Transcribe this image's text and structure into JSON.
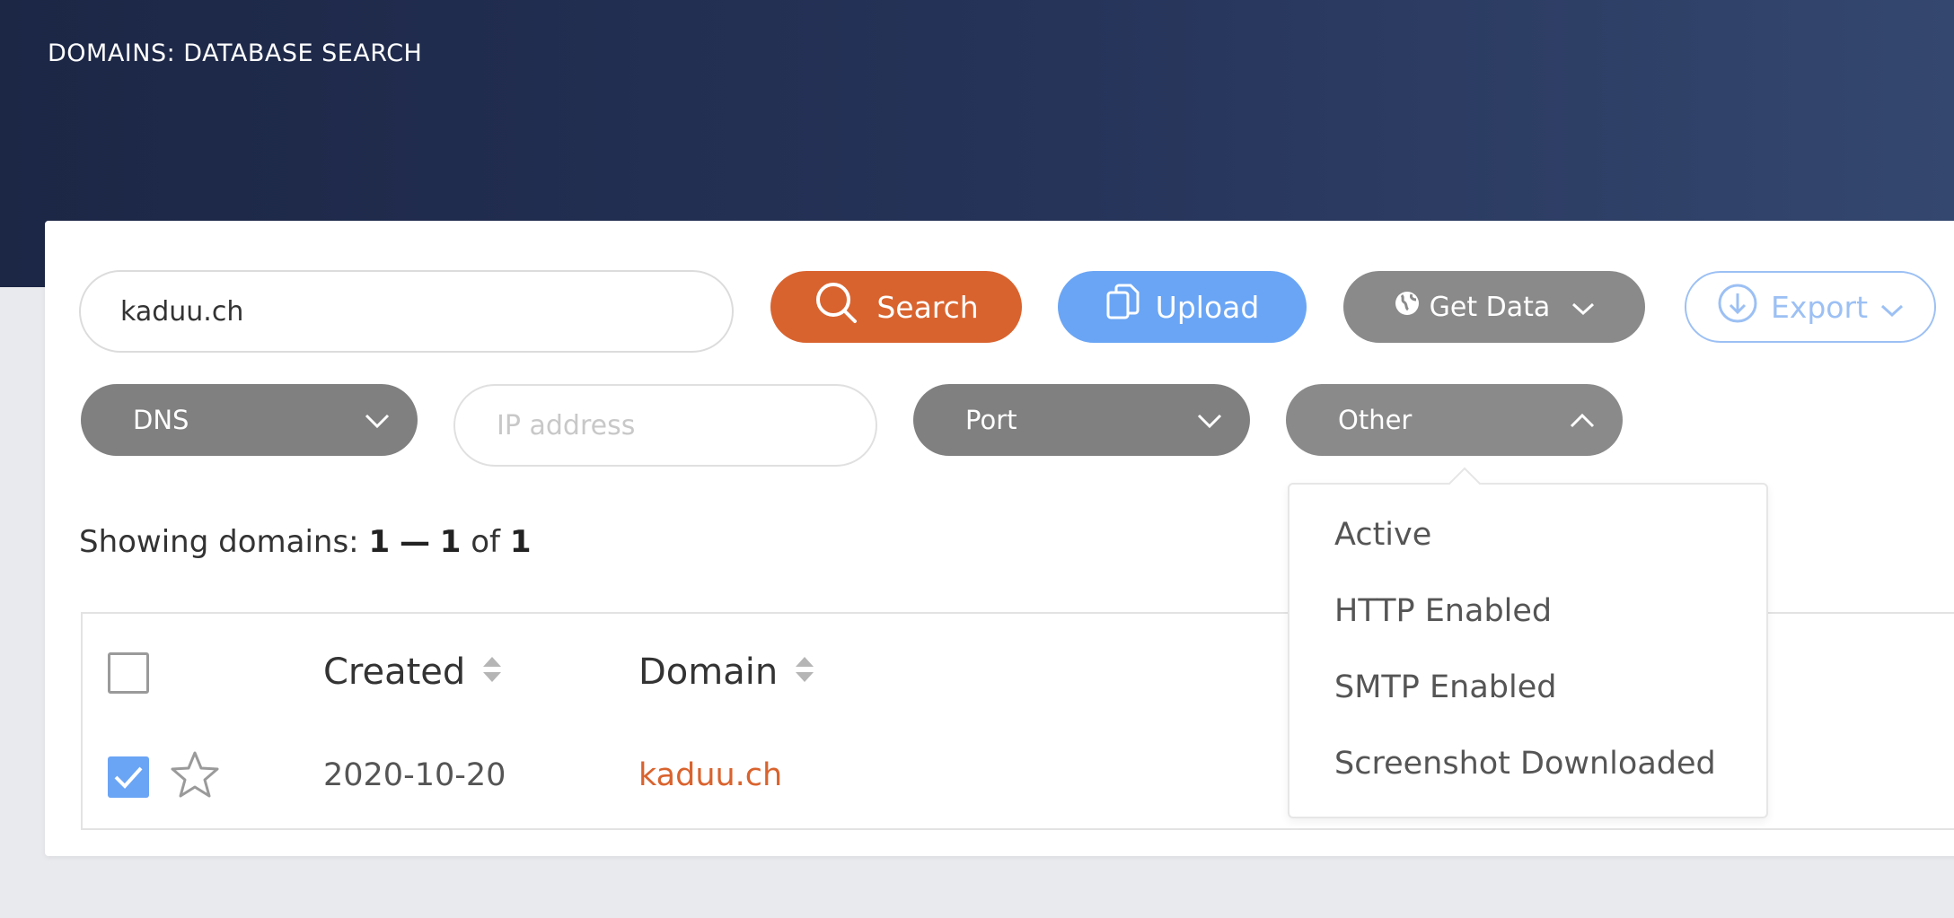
{
  "header": {
    "title": "DOMAINS: DATABASE SEARCH"
  },
  "search": {
    "value": "kaduu.ch"
  },
  "toolbar": {
    "search_label": "Search",
    "upload_label": "Upload",
    "get_data_label": "Get Data",
    "export_label": "Export"
  },
  "filters": {
    "dns_label": "DNS",
    "ip_placeholder": "IP address",
    "port_label": "Port",
    "other_label": "Other"
  },
  "dropdown": {
    "options": [
      "Active",
      "HTTP Enabled",
      "SMTP Enabled",
      "Screenshot Downloaded"
    ]
  },
  "results": {
    "prefix": "Showing domains:",
    "from": "1",
    "dash": "—",
    "to": "1",
    "of_word": "of",
    "total": "1"
  },
  "table": {
    "columns": [
      "Created",
      "Domain"
    ],
    "rows": [
      {
        "created": "2020-10-20",
        "domain": "kaduu.ch",
        "checked": true,
        "starred": false
      }
    ]
  },
  "colors": {
    "accent_orange": "#d9632e",
    "accent_blue": "#6aa5f5",
    "header_navy": "#1c2645"
  }
}
